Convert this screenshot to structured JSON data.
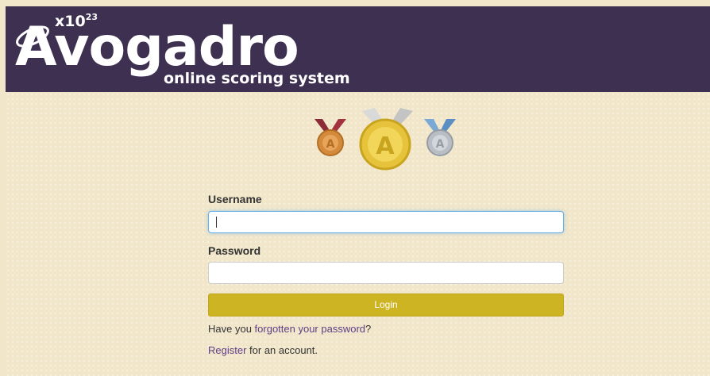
{
  "header": {
    "logo_exponent_base": "x10",
    "logo_exponent_power": "23",
    "logo_title": "Avogadro",
    "logo_subtitle": "online scoring system"
  },
  "medals": [
    {
      "name": "bronze-medal-icon",
      "color": "#d08a3d"
    },
    {
      "name": "gold-medal-icon",
      "color": "#e7c43a"
    },
    {
      "name": "silver-medal-icon",
      "color": "#b9bec4"
    }
  ],
  "login_form": {
    "username_label": "Username",
    "username_value": "",
    "password_label": "Password",
    "password_value": "",
    "login_button": "Login",
    "forgot_prefix": "Have you ",
    "forgot_link": "forgotten your password",
    "forgot_suffix": "?",
    "register_link": "Register",
    "register_suffix": " for an account."
  },
  "colors": {
    "header_bg": "#3e3050",
    "page_bg": "#f1e6c9",
    "button_bg": "#cdb422",
    "link": "#5e3d84"
  }
}
